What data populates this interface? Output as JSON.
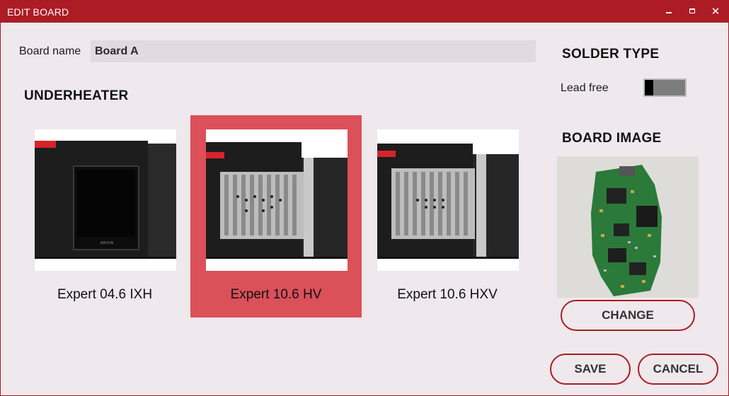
{
  "window": {
    "title": "EDIT BOARD",
    "minimize_icon": "minimize-icon",
    "maximize_icon": "maximize-icon",
    "close_icon": "close-icon",
    "close_glyph": "✕"
  },
  "board_name": {
    "label": "Board name",
    "value": "Board A"
  },
  "underheater": {
    "heading": "UNDERHEATER",
    "items": [
      {
        "name": "Expert 04.6 IXH",
        "selected": false
      },
      {
        "name": "Expert 10.6 HV",
        "selected": true
      },
      {
        "name": "Expert 10.6 HXV",
        "selected": false
      }
    ]
  },
  "solder_type": {
    "heading": "SOLDER TYPE",
    "option_label": "Lead free",
    "lead_free_on": false
  },
  "board_image": {
    "heading": "BOARD IMAGE",
    "change_label": "CHANGE"
  },
  "actions": {
    "save_label": "SAVE",
    "cancel_label": "CANCEL"
  },
  "colors": {
    "accent": "#ad1c25",
    "selected_card": "#db5059",
    "background": "#efe8ec"
  }
}
